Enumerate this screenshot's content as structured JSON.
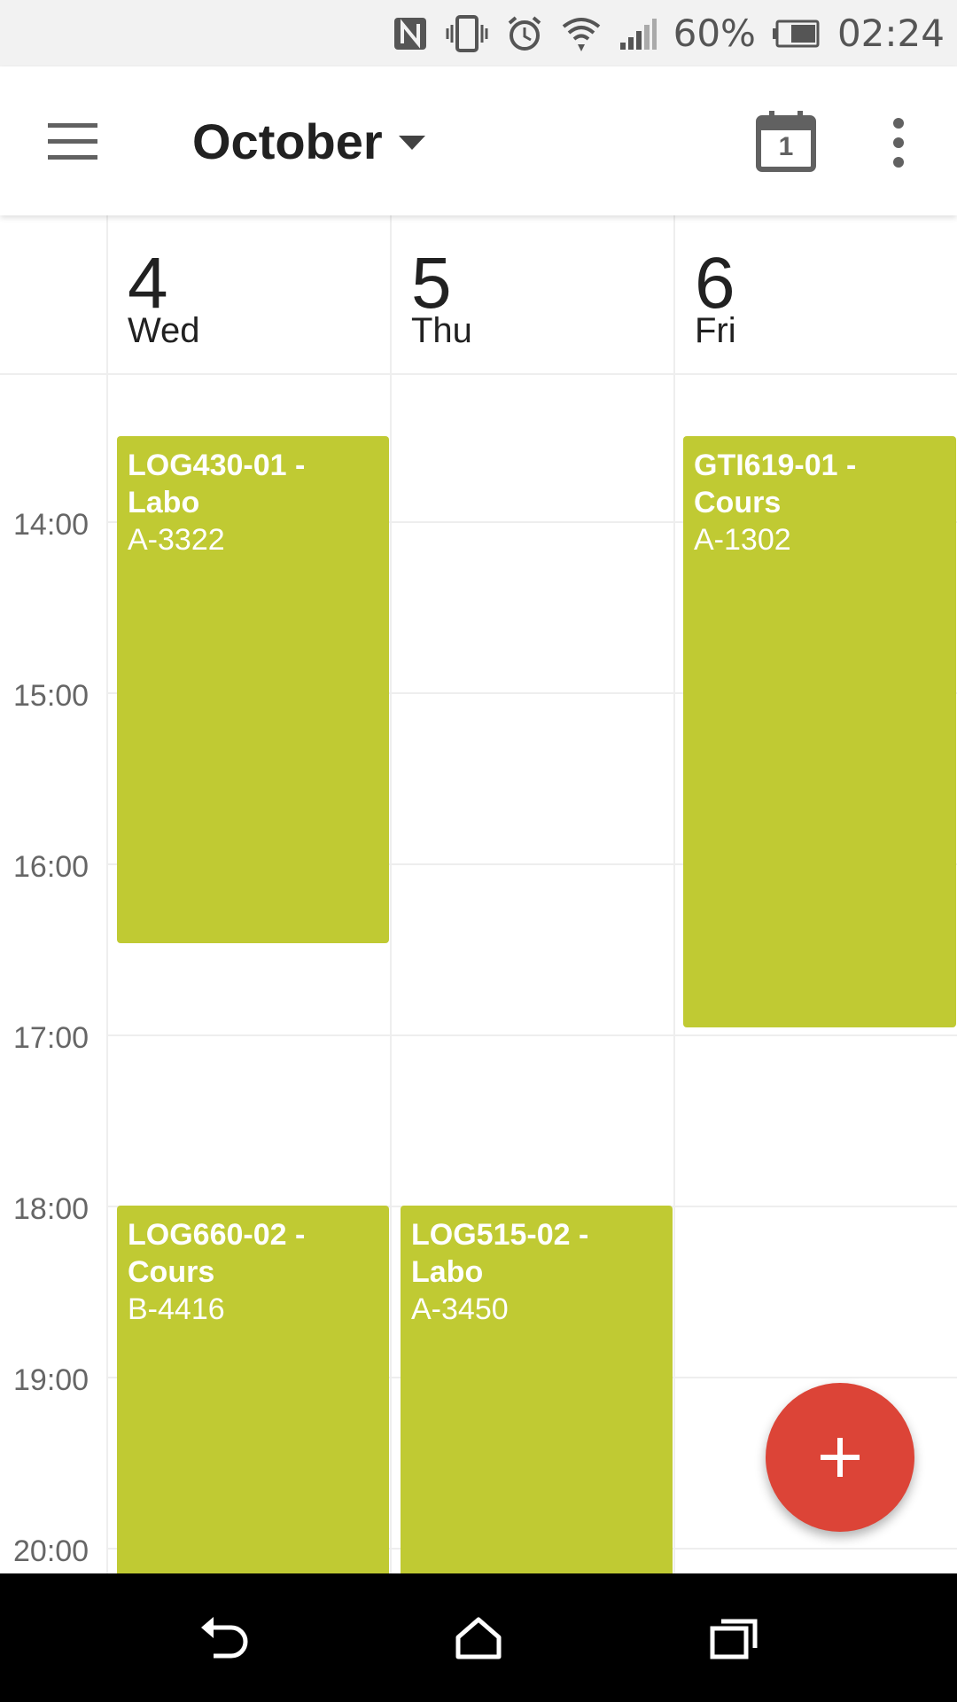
{
  "status_bar": {
    "battery_text": "60%",
    "time": "02:24",
    "icons": [
      "nfc-icon",
      "vibrate-icon",
      "alarm-icon",
      "wifi-icon",
      "signal-icon",
      "battery-icon"
    ]
  },
  "app_bar": {
    "title": "October",
    "icons": [
      "menu-icon",
      "dropdown-caret-icon",
      "today-calendar-icon",
      "more-vert-icon"
    ],
    "today_number": "1"
  },
  "days": [
    {
      "num": "4",
      "name": "Wed"
    },
    {
      "num": "5",
      "name": "Thu"
    },
    {
      "num": "6",
      "name": "Fri"
    }
  ],
  "time_labels": [
    "14:00",
    "15:00",
    "16:00",
    "17:00",
    "18:00",
    "19:00",
    "20:00"
  ],
  "events": [
    {
      "title": "LOG430-01 - Labo",
      "room": "A-3322"
    },
    {
      "title": "GTI619-01 - Cours",
      "room": "A-1302"
    },
    {
      "title": "LOG660-02 - Cours",
      "room": "B-4416"
    },
    {
      "title": "LOG515-02 - Labo",
      "room": "A-3450"
    }
  ],
  "fab": {
    "icon": "plus-icon"
  },
  "nav_bar": {
    "icons": [
      "back-icon",
      "home-icon",
      "recents-icon"
    ]
  },
  "colors": {
    "event": "#c0ca33",
    "fab": "#dc4437",
    "status_bar": "#f2f2f2"
  }
}
